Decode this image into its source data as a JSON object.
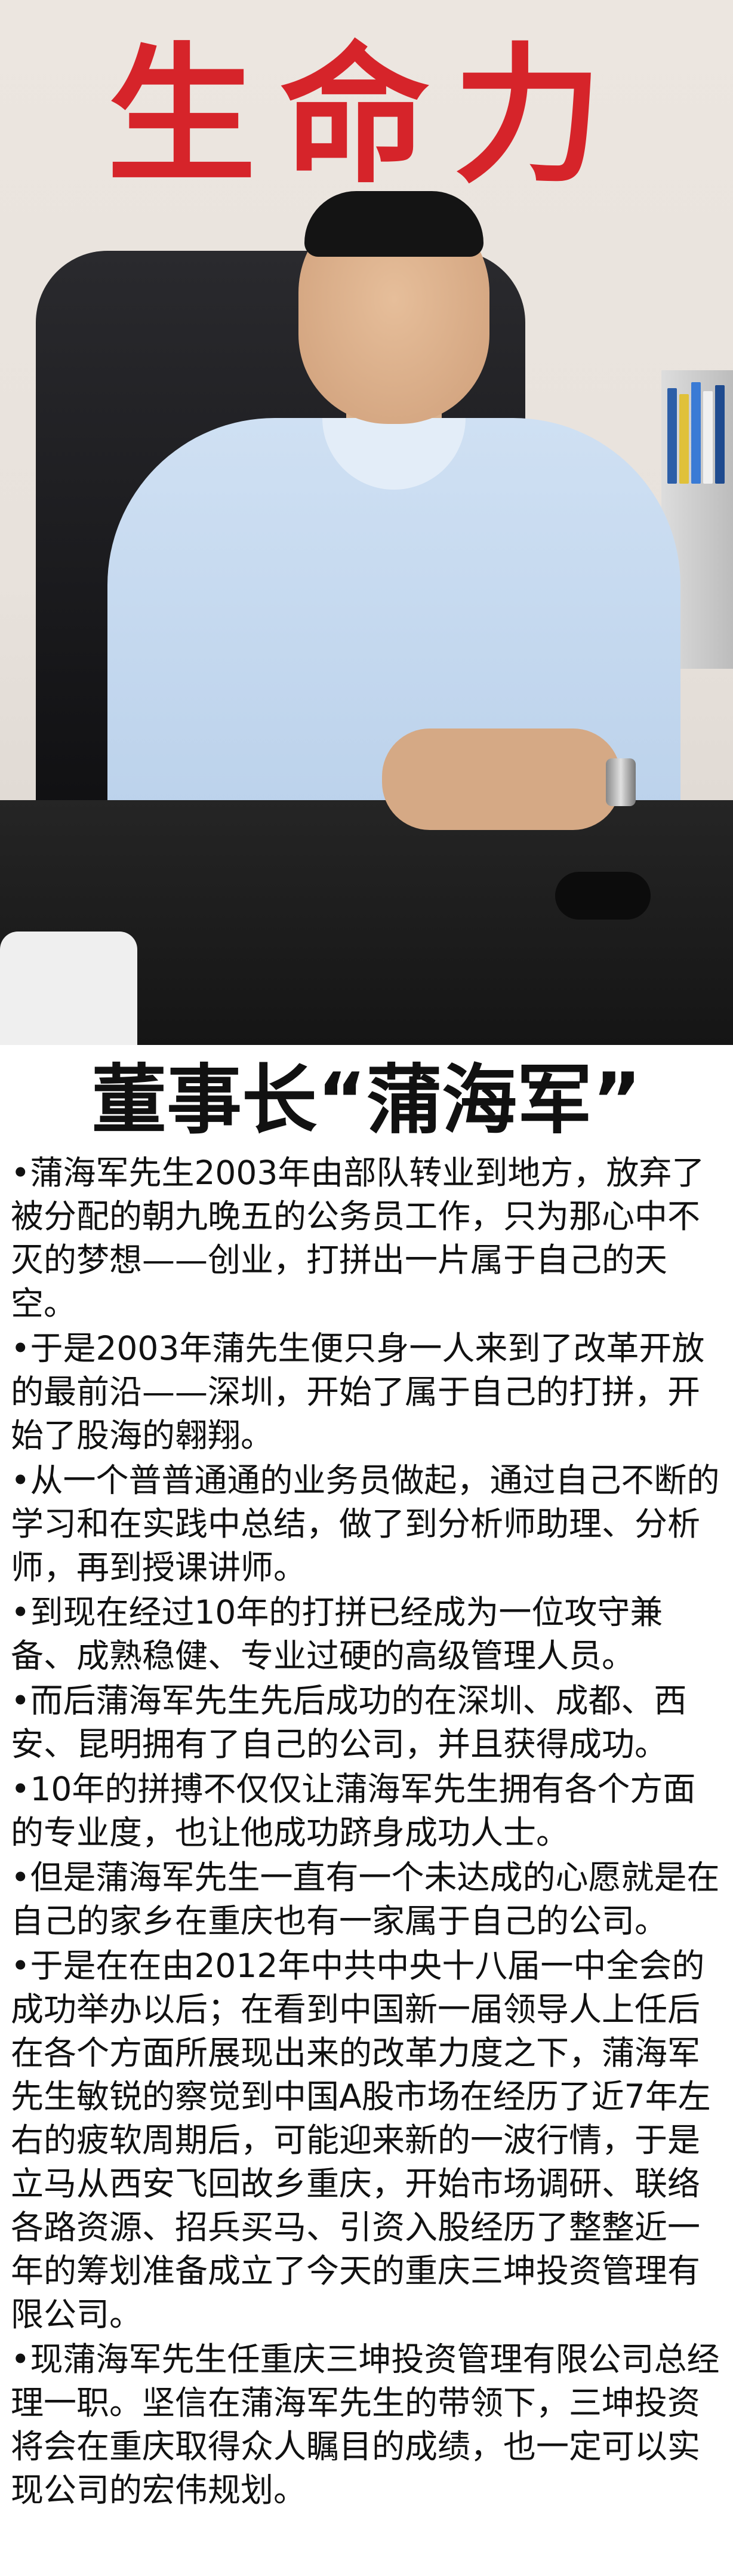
{
  "photo": {
    "wall_sign": "生命力"
  },
  "headline": "董事长“蒲海军”",
  "paragraphs": [
    "•蒲海军先生2003年由部队转业到地方，放弃了被分配的朝九晚五的公务员工作，只为那心中不灭的梦想——创业，打拼出一片属于自己的天空。",
    "•于是2003年蒲先生便只身一人来到了改革开放的最前沿——深圳，开始了属于自己的打拼，开始了股海的翱翔。",
    "•从一个普普通通的业务员做起，通过自己不断的学习和在实践中总结，做了到分析师助理、分析师，再到授课讲师。",
    "•到现在经过10年的打拼已经成为一位攻守兼备、成熟稳健、专业过硬的高级管理人员。",
    "•而后蒲海军先生先后成功的在深圳、成都、西安、昆明拥有了自己的公司，并且获得成功。",
    "•10年的拼搏不仅仅让蒲海军先生拥有各个方面的专业度，也让他成功跻身成功人士。",
    "•但是蒲海军先生一直有一个未达成的心愿就是在自己的家乡在重庆也有一家属于自己的公司。",
    "•于是在在由2012年中共中央十八届一中全会的成功举办以后；在看到中国新一届领导人上任后在各个方面所展现出来的改革力度之下，蒲海军先生敏锐的察觉到中国A股市场在经历了近7年左右的疲软周期后，可能迎来新的一波行情，于是立马从西安飞回故乡重庆，开始市场调研、联络各路资源、招兵买马、引资入股经历了整整近一年的筹划准备成立了今天的重庆三坤投资管理有限公司。",
    "•现蒲海军先生任重庆三坤投资管理有限公司总经理一职。坚信在蒲海军先生的带领下，三坤投资将会在重庆取得众人瞩目的成绩，也一定可以实现公司的宏伟规划。"
  ]
}
